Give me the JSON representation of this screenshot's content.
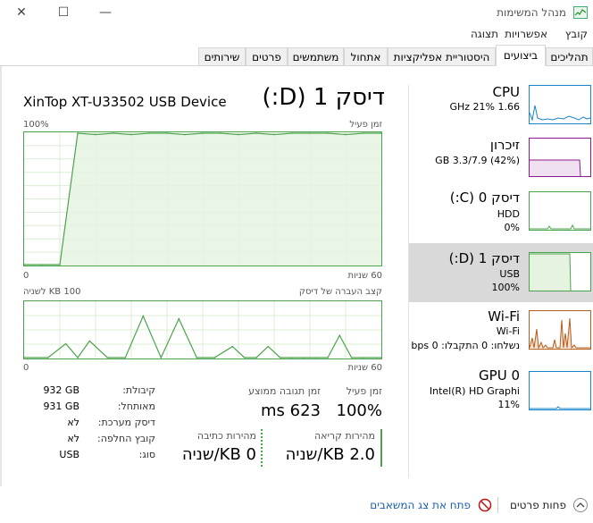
{
  "window": {
    "title": "מנהל המשימות",
    "minimize_glyph": "—",
    "maximize_glyph": "☐",
    "close_glyph": "✕",
    "icon": "task-manager-icon"
  },
  "menu": [
    "קובץ",
    "אפשרויות",
    "תצוגה"
  ],
  "tabs": [
    {
      "label": "תהליכים",
      "active": false
    },
    {
      "label": "ביצועים",
      "active": true
    },
    {
      "label": "היסטוריית אפליקציות",
      "active": false
    },
    {
      "label": "אתחול",
      "active": false
    },
    {
      "label": "משתמשים",
      "active": false
    },
    {
      "label": "פרטים",
      "active": false
    },
    {
      "label": "שירותים",
      "active": false
    }
  ],
  "sidebar": [
    {
      "title": "CPU",
      "line1": "1.66 GHz 21%",
      "line2": "",
      "color": "#1a85c8",
      "selected": false
    },
    {
      "title": "זיכרון",
      "line1": "(42%) 3.3/7.9 GB",
      "line2": "",
      "color": "#8b1a8b",
      "selected": false
    },
    {
      "title": "דיסק 0 (C:)",
      "line1": "HDD",
      "line2": "0%",
      "color": "#4da34d",
      "selected": false
    },
    {
      "title": "דיסק 1 (D:)",
      "line1": "USB",
      "line2": "100%",
      "color": "#4da34d",
      "selected": true
    },
    {
      "title": "Wi-Fi",
      "line1": "Wi-Fi",
      "line2": "נשלחו: 0 התקבלו: 0 bps",
      "color": "#b35d1a",
      "selected": false
    },
    {
      "title": "GPU 0",
      "line1": "Intel(R) HD Graphi",
      "line2": "11%",
      "color": "#1a85c8",
      "selected": false
    }
  ],
  "main": {
    "title": "דיסק 1 (D:)",
    "device": "XinTop XT-U33502 USB Device",
    "graph1": {
      "left_top": "100%",
      "right_top": "זמן פעיל",
      "left_bottom": "0",
      "right_bottom": "60 שניות"
    },
    "graph2": {
      "left_top": "100 KB לשניה",
      "right_top": "קצב העברה של דיסק",
      "left_bottom": "0",
      "right_bottom": "60 שניות"
    },
    "stats": {
      "active_time_label": "זמן פעיל",
      "active_time_value": "100%",
      "response_label": "זמן תגובה ממוצע",
      "response_value": "623 ms",
      "read_label": "מהירות קריאה",
      "read_value": "2.0 KB/שניה",
      "write_label": "מהירות כתיבה",
      "write_value": "0 KB/שניה"
    },
    "props": [
      {
        "label": "קיבולת:",
        "value": "932 GB"
      },
      {
        "label": "מאותחל:",
        "value": "931 GB"
      },
      {
        "label": "דיסק מערכת:",
        "value": "לא"
      },
      {
        "label": "קובץ החלפה:",
        "value": "לא"
      },
      {
        "label": "סוג:",
        "value": "USB"
      }
    ]
  },
  "bottom": {
    "fewer_details": "פחות פרטים",
    "open_monitor": "פתח את צג המשאבים"
  },
  "colors": {
    "disk_green": "#4da34d",
    "disk_fill": "#e5f3e0",
    "link_blue": "#1a5fb4",
    "selected_bg": "#d9d9d9"
  },
  "chart_data": [
    {
      "type": "area",
      "title": "זמן פעיל",
      "x": [
        60,
        57,
        54,
        51,
        48,
        45,
        42,
        39,
        36,
        33,
        30,
        27,
        24,
        21,
        18,
        15,
        12,
        9,
        6,
        3,
        0
      ],
      "values": [
        0,
        0,
        0,
        100,
        99,
        100,
        99,
        100,
        100,
        99,
        100,
        100,
        99,
        100,
        99,
        100,
        100,
        100,
        99,
        100,
        100
      ],
      "ylim": [
        0,
        100
      ],
      "ylabel": "100%",
      "xlabel": "60 שניות"
    },
    {
      "type": "line",
      "title": "קצב העברה של דיסק",
      "x": [
        60,
        56,
        53,
        51,
        49,
        46,
        43,
        40,
        37,
        34,
        31,
        28,
        25,
        23,
        21,
        19,
        17,
        15,
        13,
        11,
        9,
        7,
        5,
        3,
        0
      ],
      "values": [
        0,
        0,
        25,
        0,
        30,
        0,
        0,
        75,
        0,
        70,
        0,
        0,
        20,
        0,
        0,
        20,
        0,
        0,
        0,
        0,
        0,
        40,
        0,
        0,
        0
      ],
      "ylim": [
        0,
        100
      ],
      "ylabel": "100 KB לשניה",
      "xlabel": "60 שניות"
    }
  ]
}
